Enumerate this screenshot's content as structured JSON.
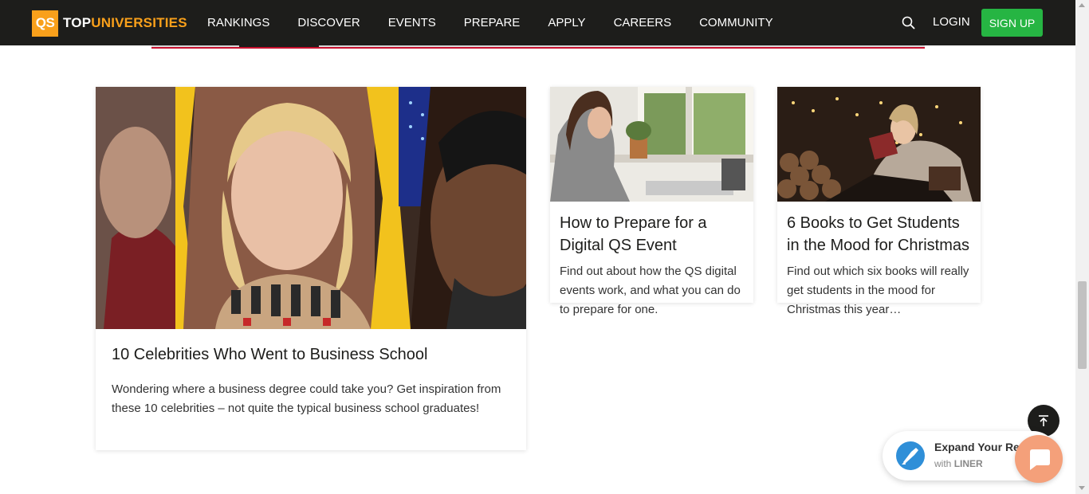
{
  "nav": {
    "logo_badge": "QS",
    "logo_word1": "TOP",
    "logo_word2": "UNIVERSITIES",
    "items": [
      "RANKINGS",
      "DISCOVER",
      "EVENTS",
      "PREPARE",
      "APPLY",
      "CAREERS",
      "COMMUNITY"
    ],
    "search_icon": "search-icon",
    "login_label": "LOGIN",
    "signup_label": "SIGN UP",
    "bg_color": "#1d1d1b",
    "accent_color": "#f9a01b",
    "signup_color": "#26b543"
  },
  "articles": [
    {
      "title": "10 Celebrities Who Went to Business School",
      "description": "Wondering where a business degree could take you? Get inspiration from these 10 celebrities – not quite the typical business school graduates!"
    },
    {
      "title": "How to Prepare for a Digital QS Event",
      "description": "Find out about how the QS digital events work, and what you can do to prepare for one."
    },
    {
      "title": "6 Books to Get Students in the Mood for Christmas",
      "description": "Find out which six books will really get students in the mood for Christmas this year…"
    }
  ],
  "back_to_top_icon": "arrow-up-icon",
  "liner": {
    "title": "Expand Your Re",
    "sub_prefix": "with",
    "sub_brand": "LINER"
  },
  "chat_icon": "chat-bubble-icon"
}
